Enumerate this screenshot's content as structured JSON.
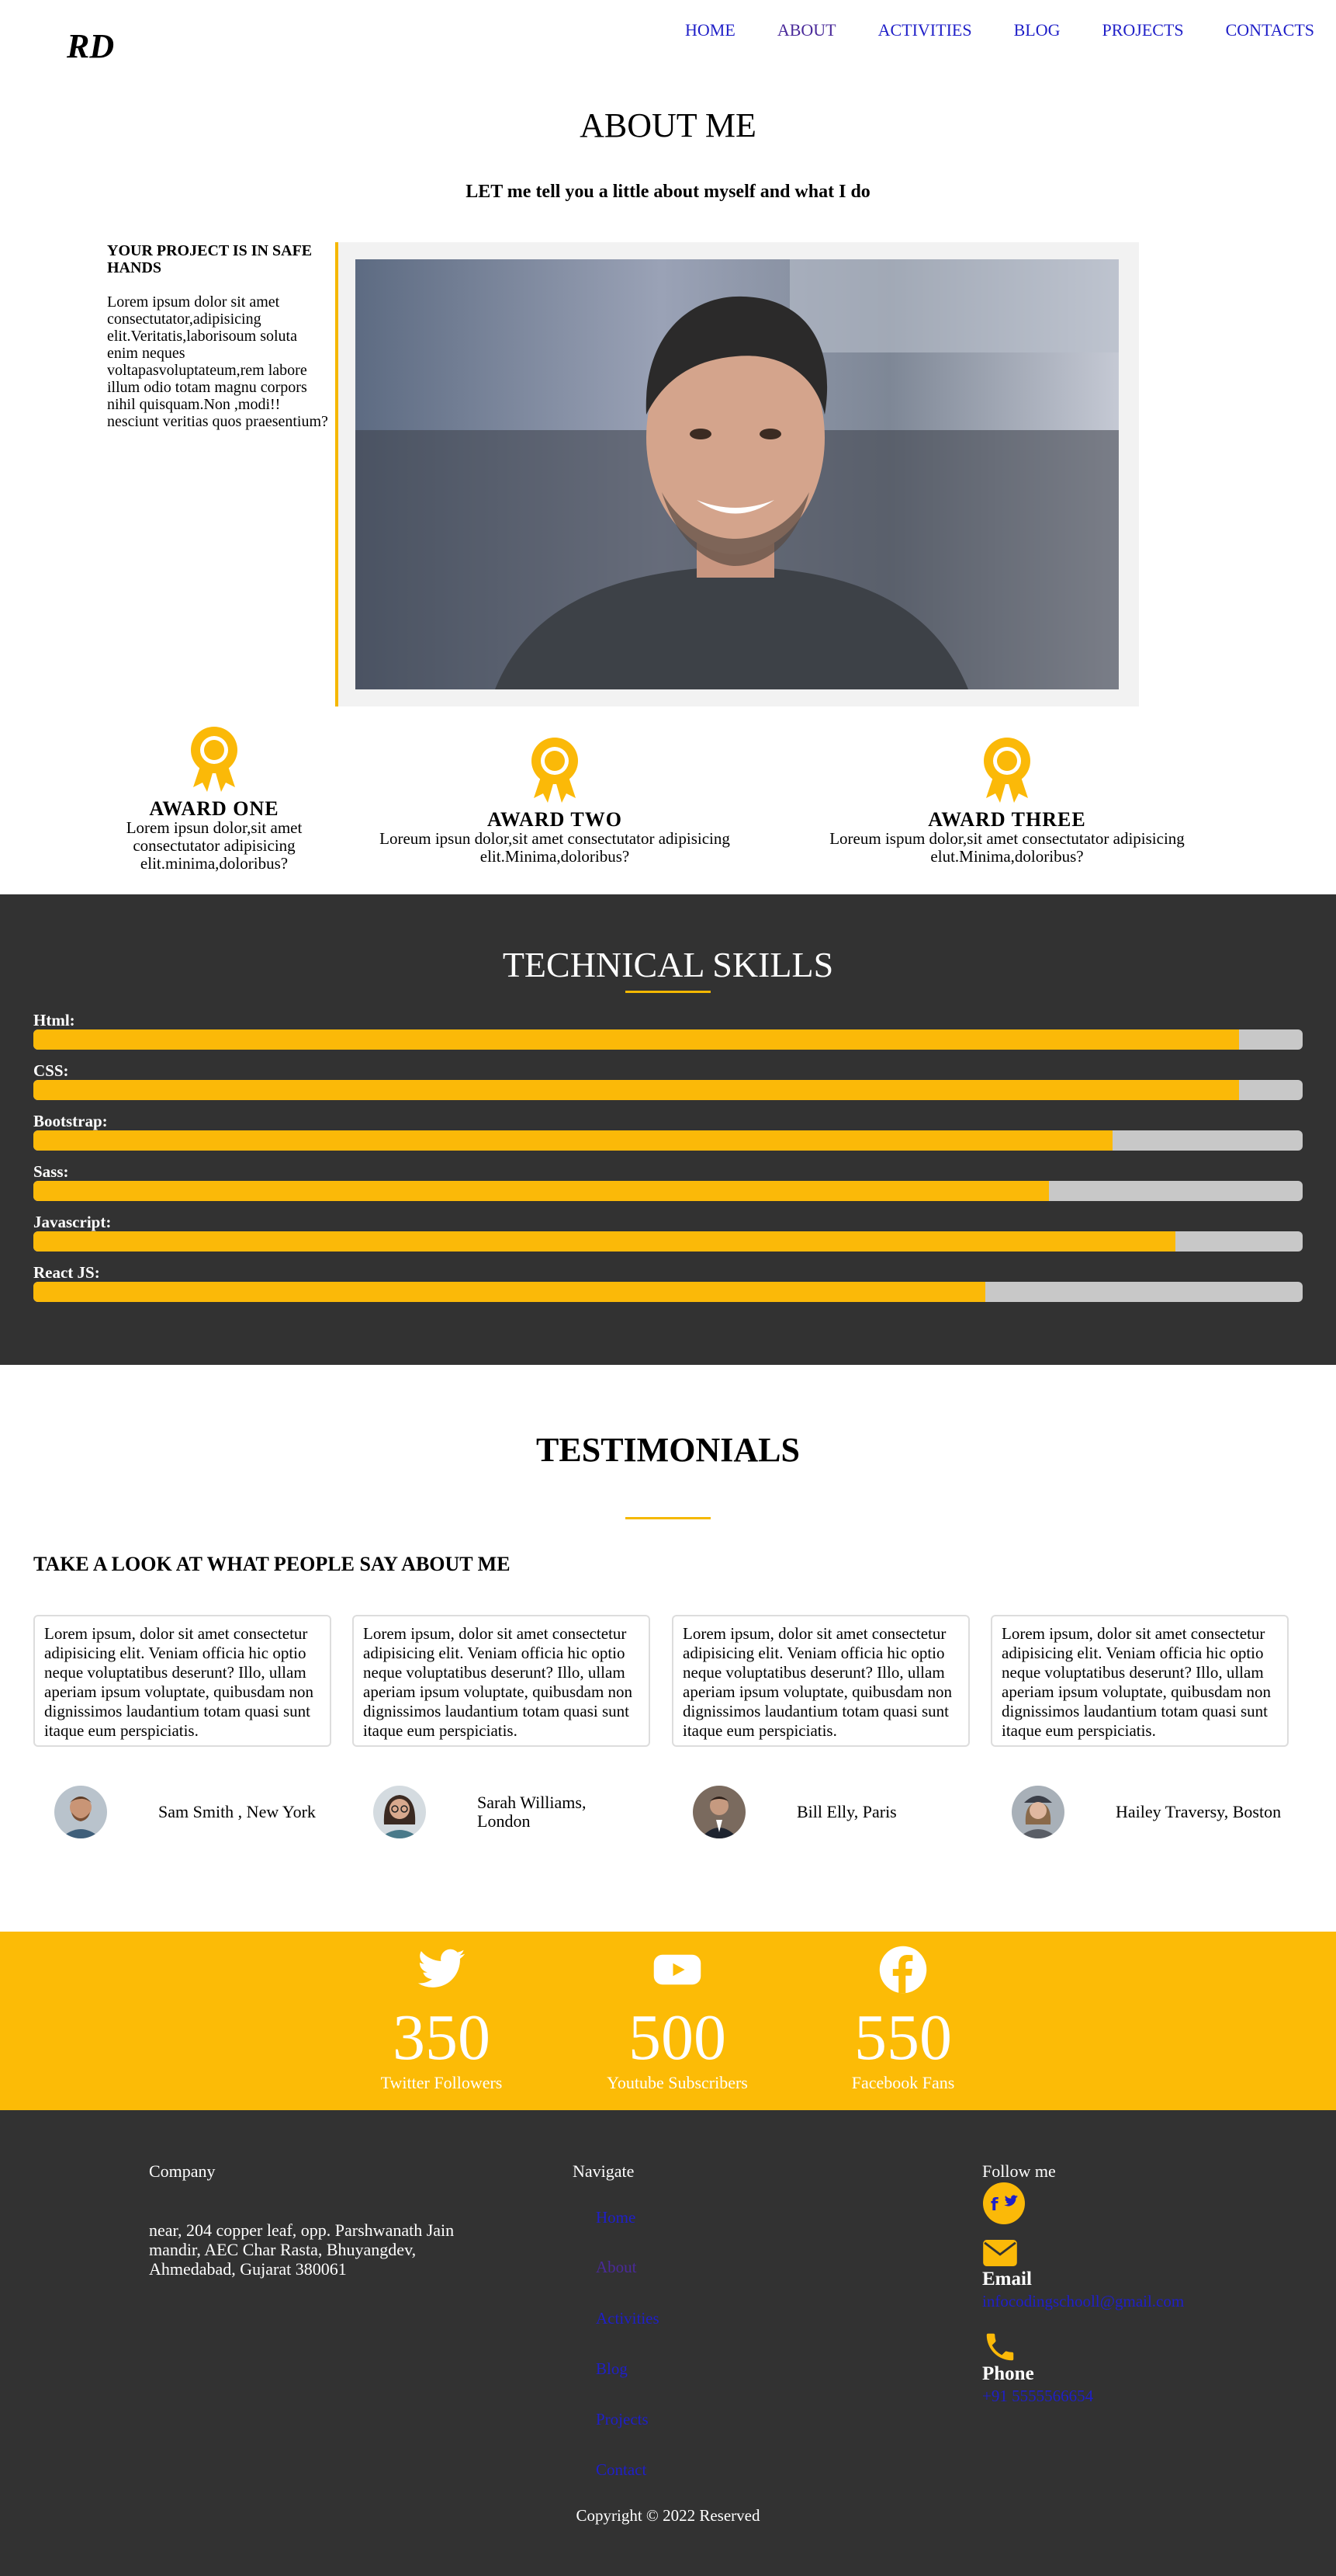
{
  "brand": {
    "logo": "RD"
  },
  "nav": [
    "HOME",
    "ABOUT",
    "ACTIVITIES",
    "BLOG",
    "PROJECTS",
    "CONTACTS"
  ],
  "about": {
    "title": "ABOUT ME",
    "subtitle": "LET me tell you a little about myself and what I do",
    "heading": "YOUR PROJECT IS IN SAFE HANDS",
    "body": "Lorem ipsum dolor sit amet consectutator,adipisicing elit.Veritatis,laborisoum soluta enim neques voltapasvoluptateum,rem labore illum odio totam magnu corpors nihil quisquam.Non ,modi!! nesciunt veritias quos praesentium?"
  },
  "awards": [
    {
      "title": "AWARD ONE",
      "text": "Lorem ipsun dolor,sit amet consectutator adipisicing elit.minima,doloribus?"
    },
    {
      "title": "AWARD TWO",
      "text": "Loreum ipsun dolor,sit amet consectutator adipisicing elit.Minima,doloribus?"
    },
    {
      "title": "AWARD THREE",
      "text": "Loreum ispum dolor,sit amet consectutator adipisicing elut.Minima,doloribus?"
    }
  ],
  "skills": {
    "title": "TECHNICAL SKILLS",
    "items": [
      {
        "name": "Html:",
        "level": 95
      },
      {
        "name": "CSS:",
        "level": 95
      },
      {
        "name": "Bootstrap:",
        "level": 85
      },
      {
        "name": "Sass:",
        "level": 80
      },
      {
        "name": "Javascript:",
        "level": 90
      },
      {
        "name": "React JS:",
        "level": 75
      }
    ]
  },
  "testimonials": {
    "title": "TESTIMONIALS",
    "subtitle": "TAKE A LOOK AT WHAT PEOPLE SAY ABOUT ME",
    "quote": "Lorem ipsum, dolor sit amet consectetur adipisicing elit. Veniam officia hic optio neque voluptatibus deserunt? Illo, ullam aperiam ipsum voluptate, quibusdam non dignissimos laudantium totam quasi sunt itaque eum perspiciatis.",
    "people": [
      "Sam Smith , New York",
      "Sarah Williams, London",
      "Bill Elly, Paris",
      "Hailey Traversy, Boston"
    ]
  },
  "stats": [
    {
      "icon": "twitter-icon",
      "number": "350",
      "label": "Twitter Followers"
    },
    {
      "icon": "youtube-icon",
      "number": "500",
      "label": "Youtube Subscribers"
    },
    {
      "icon": "facebook-icon",
      "number": "550",
      "label": "Facebook Fans"
    }
  ],
  "footer": {
    "company_heading": "Company",
    "address": "near, 204 copper leaf, opp. Parshwanath Jain mandir, AEC Char Rasta, Bhuyangdev, Ahmedabad, Gujarat 380061",
    "navigate_heading": "Navigate",
    "links": [
      "Home",
      "About",
      "Activities",
      "Blog",
      "Projects",
      "Contact"
    ],
    "follow_heading": "Follow me",
    "email_label": "Email",
    "email_value": "infocodingschooll@gmail.com",
    "phone_label": "Phone",
    "phone_value": "+91 5555566654",
    "copyright": "Copyright © 2022 Reserved"
  },
  "colors": {
    "accent": "#fbb908",
    "dark": "#323232",
    "link": "#1f1fc8"
  }
}
